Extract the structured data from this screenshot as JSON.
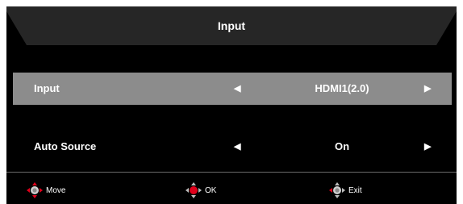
{
  "header": {
    "title": "Input"
  },
  "rows": [
    {
      "label": "Input",
      "value": "HDMI1(2.0)",
      "selected": true
    },
    {
      "label": "Auto Source",
      "value": "On",
      "selected": false
    }
  ],
  "glyphs": {
    "arrow_left": "◀",
    "arrow_right": "▶"
  },
  "footer": {
    "move_label": "Move",
    "ok_label": "OK",
    "exit_label": "Exit"
  },
  "icons": {
    "nav": "dpad-icon",
    "ok": "dpad-icon",
    "exit": "dpad-icon"
  },
  "colors": {
    "background": "#000000",
    "selected_row": "#8c8c8c",
    "accent": "#e0001b",
    "title_band": "#262626"
  }
}
